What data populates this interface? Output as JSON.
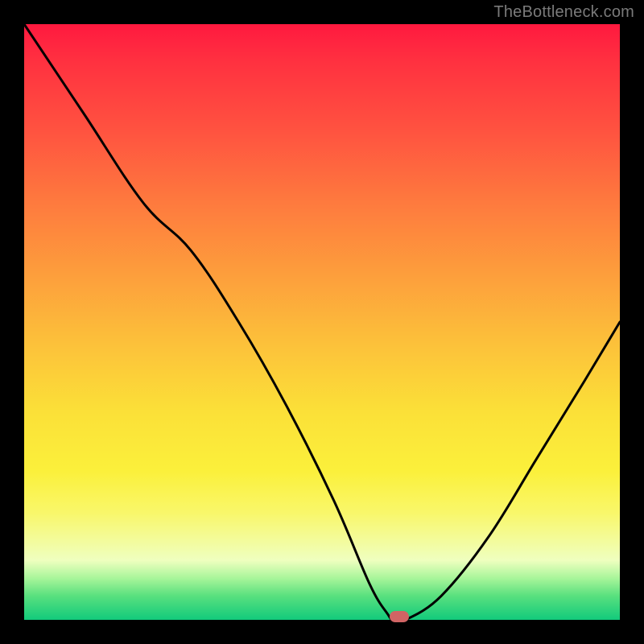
{
  "watermark": "TheBottleneck.com",
  "chart_data": {
    "type": "line",
    "title": "",
    "xlabel": "",
    "ylabel": "",
    "xlim": [
      0,
      100
    ],
    "ylim": [
      0,
      100
    ],
    "grid": false,
    "series": [
      {
        "name": "bottleneck-curve",
        "x": [
          0,
          10,
          20,
          28,
          36,
          44,
          52,
          58,
          61,
          62,
          64,
          70,
          78,
          86,
          94,
          100
        ],
        "values": [
          100,
          85,
          70,
          62,
          50,
          36,
          20,
          6,
          1,
          0,
          0,
          4,
          14,
          27,
          40,
          50
        ]
      }
    ],
    "marker": {
      "x": 63,
      "y": 0.5
    },
    "background_gradient": {
      "top": "#ff193f",
      "mid_upper": "#fd9e3c",
      "mid": "#fbe038",
      "mid_lower": "#efffbf",
      "bottom": "#12ca7c"
    }
  }
}
